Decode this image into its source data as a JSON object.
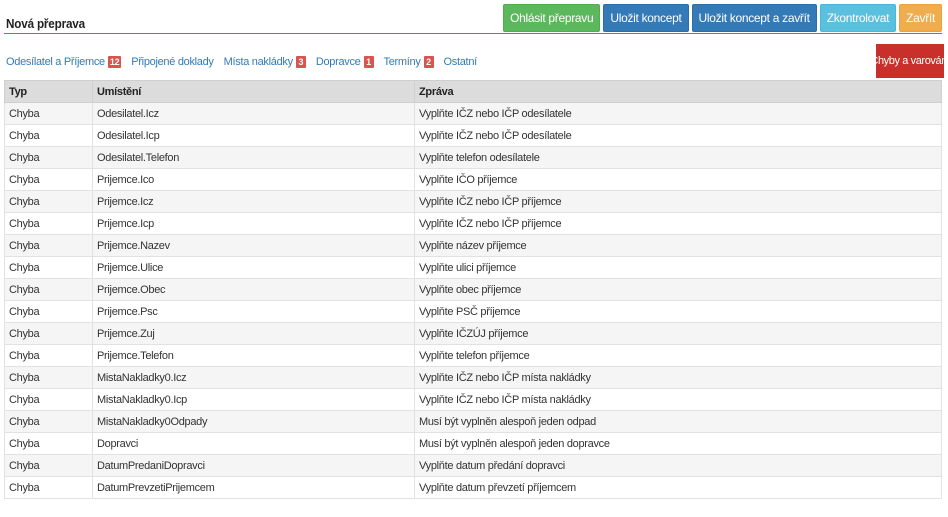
{
  "header": {
    "title": "Nová přeprava"
  },
  "actions": {
    "report": "Ohlásit přepravu",
    "save_draft": "Uložit koncept",
    "save_draft_close": "Uložit koncept a zavřít",
    "check": "Zkontrolovat",
    "close": "Zavřít"
  },
  "colors": {
    "green": "#5cb85c",
    "blue": "#337ab7",
    "info": "#5bc0de",
    "orange": "#f0ad4e",
    "danger": "#c9302c"
  },
  "tabs": [
    {
      "label": "Odesílatel a Příjemce",
      "badge": "12"
    },
    {
      "label": "Připojené doklady",
      "badge": ""
    },
    {
      "label": "Místa nakládky",
      "badge": "3"
    },
    {
      "label": "Dopravce",
      "badge": "1"
    },
    {
      "label": "Termíny",
      "badge": "2"
    },
    {
      "label": "Ostatní",
      "badge": ""
    }
  ],
  "errors_button": "Chyby a varování",
  "table": {
    "columns": [
      "Typ",
      "Umístění",
      "Zpráva"
    ],
    "rows": [
      [
        "Chyba",
        "Odesilatel.Icz",
        "Vyplňte IČZ nebo IČP odesílatele"
      ],
      [
        "Chyba",
        "Odesilatel.Icp",
        "Vyplňte IČZ nebo IČP odesílatele"
      ],
      [
        "Chyba",
        "Odesilatel.Telefon",
        "Vyplňte telefon odesílatele"
      ],
      [
        "Chyba",
        "Prijemce.Ico",
        "Vyplňte IČO příjemce"
      ],
      [
        "Chyba",
        "Prijemce.Icz",
        "Vyplňte IČZ nebo IČP příjemce"
      ],
      [
        "Chyba",
        "Prijemce.Icp",
        "Vyplňte IČZ nebo IČP příjemce"
      ],
      [
        "Chyba",
        "Prijemce.Nazev",
        "Vyplňte název příjemce"
      ],
      [
        "Chyba",
        "Prijemce.Ulice",
        "Vyplňte ulici příjemce"
      ],
      [
        "Chyba",
        "Prijemce.Obec",
        "Vyplňte obec příjemce"
      ],
      [
        "Chyba",
        "Prijemce.Psc",
        "Vyplňte PSČ příjemce"
      ],
      [
        "Chyba",
        "Prijemce.Zuj",
        "Vyplňte IČZÚJ příjemce"
      ],
      [
        "Chyba",
        "Prijemce.Telefon",
        "Vyplňte telefon příjemce"
      ],
      [
        "Chyba",
        "MistaNakladky0.Icz",
        "Vyplňte IČZ nebo IČP místa nakládky"
      ],
      [
        "Chyba",
        "MistaNakladky0.Icp",
        "Vyplňte IČZ nebo IČP místa nakládky"
      ],
      [
        "Chyba",
        "MistaNakladky0Odpady",
        "Musí být vyplněn alespoň jeden odpad"
      ],
      [
        "Chyba",
        "Dopravci",
        "Musí být vyplněn alespoň jeden dopravce"
      ],
      [
        "Chyba",
        "DatumPredaniDopravci",
        "Vyplňte datum předání dopravci"
      ],
      [
        "Chyba",
        "DatumPrevzetiPrijemcem",
        "Vyplňte datum převzetí příjemcem"
      ]
    ]
  }
}
